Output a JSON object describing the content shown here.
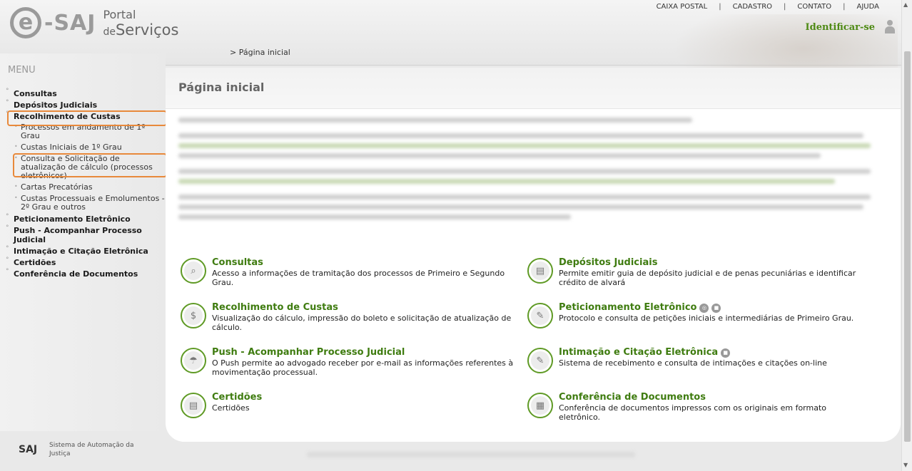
{
  "header": {
    "logo": {
      "e": "e",
      "saj": "-SAJ",
      "portal": "Portal",
      "de": "de",
      "servicos": "Serviços"
    },
    "topnav": [
      "CAIXA POSTAL",
      "CADASTRO",
      "CONTATO",
      "AJUDA"
    ],
    "separator": "|",
    "identify_label": "Identificar-se",
    "breadcrumb": "> Página inicial"
  },
  "sidebar": {
    "menu_title": "MENU",
    "items": [
      {
        "label": "Consultas"
      },
      {
        "label": "Depósitos Judiciais"
      },
      {
        "label": "Recolhimento de Custas"
      },
      {
        "label": "Processos em andamento de 1º Grau"
      },
      {
        "label": "Custas Iniciais de 1º Grau"
      },
      {
        "label": "Consulta e Solicitação de atualização de cálculo (processos eletrônicos)"
      },
      {
        "label": "Cartas Precatórias"
      },
      {
        "label": "Custas Processuais e Emolumentos - 2º Grau e outros"
      },
      {
        "label": "Peticionamento Eletrônico"
      },
      {
        "label": "Push - Acompanhar Processo Judicial"
      },
      {
        "label": "Intimação e Citação Eletrônica"
      },
      {
        "label": "Certidões"
      },
      {
        "label": "Conferência de Documentos"
      }
    ]
  },
  "main": {
    "title": "Página inicial",
    "cards": [
      {
        "title": "Consultas",
        "desc": "Acesso a informações de tramitação dos processos de Primeiro e Segundo Grau.",
        "icon": "search-doc-icon"
      },
      {
        "title": "Depósitos Judiciais",
        "desc": "Permite emitir guia de depósito judicial e de penas pecuniárias e identificar crédito de alvará",
        "icon": "document-icon"
      },
      {
        "title": "Recolhimento de Custas",
        "desc": "Visualização do cálculo, impressão do boleto e solicitação de atualização de cálculo.",
        "icon": "money-doc-icon"
      },
      {
        "title": "Peticionamento Eletrônico",
        "desc": "Protocolo e consulta de petições iniciais e intermediárias de Primeiro Grau.",
        "icon": "petition-icon"
      },
      {
        "title": "Push - Acompanhar Processo Judicial",
        "desc": "O Push permite ao advogado receber por e-mail as informações referentes à movimentação processual.",
        "icon": "parachute-icon"
      },
      {
        "title": "Intimação e Citação Eletrônica",
        "desc": "Sistema de recebimento e consulta de intimações e citações on-line",
        "icon": "summons-icon"
      },
      {
        "title": "Certidões",
        "desc": "Certidões",
        "icon": "certificate-icon"
      },
      {
        "title": "Conferência de Documentos",
        "desc": "Conferência de documentos impressos com os originais em formato eletrônico.",
        "icon": "documents-stack-icon"
      }
    ]
  },
  "footer": {
    "logo": "SAJ",
    "text": "Sistema de Automação da Justiça"
  },
  "colors": {
    "accent": "#3f7c10",
    "highlight": "#e8893b"
  }
}
